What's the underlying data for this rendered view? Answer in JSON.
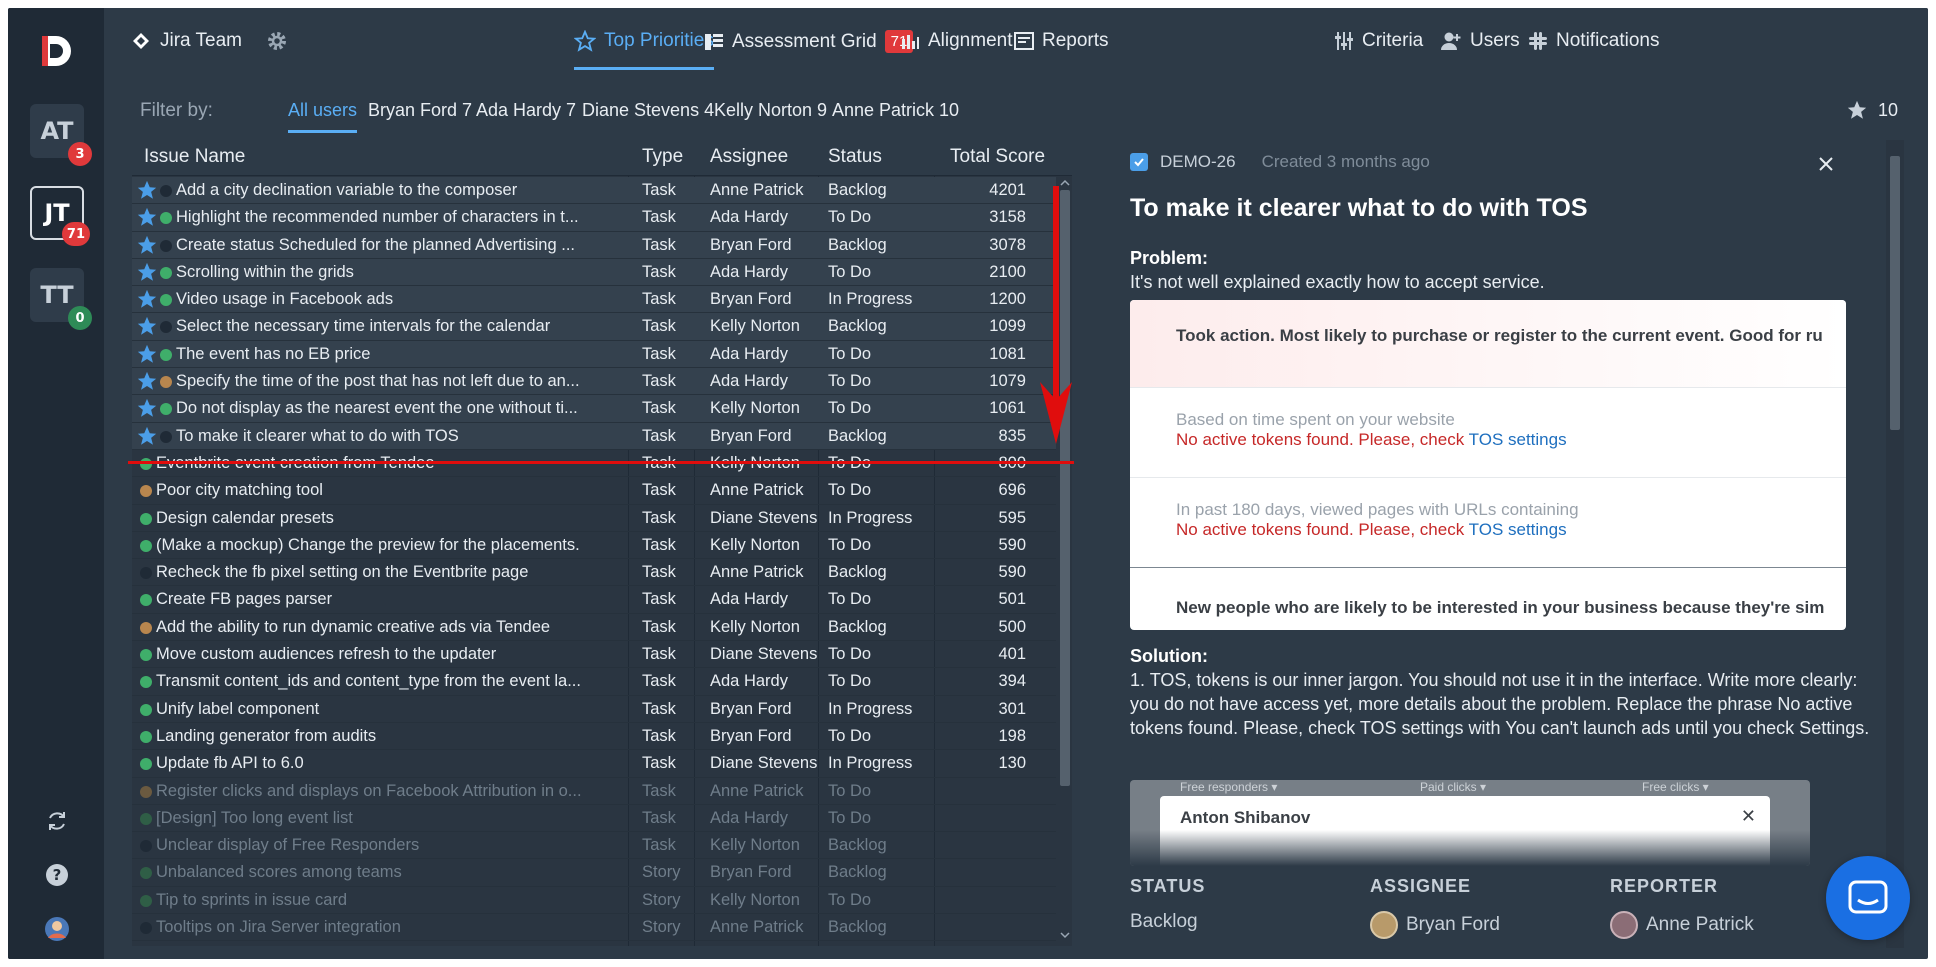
{
  "app": {
    "logo_letter": "D"
  },
  "rail": {
    "workspaces": [
      {
        "label": "AT",
        "badge": "3",
        "badge_color": "#e0393b"
      },
      {
        "label": "JT",
        "badge": "71",
        "badge_color": "#e0393b"
      },
      {
        "label": "TT",
        "badge": "0",
        "badge_color": "#2e8b57"
      }
    ]
  },
  "topnav": {
    "team": "Jira Team",
    "top_priorities": "Top Priorities",
    "assessment_grid": "Assessment Grid",
    "assessment_badge": "71",
    "alignment": "Alignment",
    "reports": "Reports",
    "criteria": "Criteria",
    "users": "Users",
    "notifications": "Notifications"
  },
  "filter": {
    "label": "Filter by:",
    "options": [
      "All users",
      "Bryan Ford 7",
      "Ada Hardy 7",
      "Diane Stevens 4",
      "Kelly Norton 9",
      "Anne Patrick 10"
    ],
    "star_count": "10"
  },
  "table": {
    "headers": {
      "name": "Issue Name",
      "type": "Type",
      "assignee": "Assignee",
      "status": "Status",
      "score": "Total Score"
    },
    "rows": [
      {
        "starred": true,
        "dot": "#1f2a36",
        "name": "Add a city declination variable to the composer",
        "type": "Task",
        "assignee": "Anne Patrick",
        "status": "Backlog",
        "score": "4201"
      },
      {
        "starred": true,
        "dot": "#3fae6a",
        "name": "Highlight the recommended number of characters in t...",
        "type": "Task",
        "assignee": "Ada Hardy",
        "status": "To Do",
        "score": "3158"
      },
      {
        "starred": true,
        "dot": "#1f2a36",
        "name": "Create status Scheduled for the planned Advertising ...",
        "type": "Task",
        "assignee": "Bryan Ford",
        "status": "Backlog",
        "score": "3078"
      },
      {
        "starred": true,
        "dot": "#3fae6a",
        "name": "Scrolling within the grids",
        "type": "Task",
        "assignee": "Ada Hardy",
        "status": "To Do",
        "score": "2100"
      },
      {
        "starred": true,
        "dot": "#3fae6a",
        "name": "Video usage in Facebook ads",
        "type": "Task",
        "assignee": "Bryan Ford",
        "status": "In Progress",
        "score": "1200"
      },
      {
        "starred": true,
        "dot": "#1f2a36",
        "name": "Select the necessary time intervals for the calendar",
        "type": "Task",
        "assignee": "Kelly Norton",
        "status": "Backlog",
        "score": "1099"
      },
      {
        "starred": true,
        "dot": "#3fae6a",
        "name": "The event has no EB price",
        "type": "Task",
        "assignee": "Ada Hardy",
        "status": "To Do",
        "score": "1081"
      },
      {
        "starred": true,
        "dot": "#b8864e",
        "name": "Specify the time of the post that has not left due to an...",
        "type": "Task",
        "assignee": "Ada Hardy",
        "status": "To Do",
        "score": "1079"
      },
      {
        "starred": true,
        "dot": "#3fae6a",
        "name": "Do not display as the nearest event the one without ti...",
        "type": "Task",
        "assignee": "Kelly Norton",
        "status": "To Do",
        "score": "1061"
      },
      {
        "starred": true,
        "dot": "#1f2a36",
        "name": "To make it clearer what to do with TOS",
        "type": "Task",
        "assignee": "Bryan Ford",
        "status": "Backlog",
        "score": "835"
      },
      {
        "starred": false,
        "dot": "#3fae6a",
        "name": "Eventbrite event creation from Tendee",
        "type": "Task",
        "assignee": "Kelly Norton",
        "status": "To Do",
        "score": "800"
      },
      {
        "starred": false,
        "dot": "#b8864e",
        "name": "Poor city matching tool",
        "type": "Task",
        "assignee": "Anne Patrick",
        "status": "To Do",
        "score": "696"
      },
      {
        "starred": false,
        "dot": "#3fae6a",
        "name": "Design calendar presets",
        "type": "Task",
        "assignee": "Diane Stevens",
        "status": "In Progress",
        "score": "595"
      },
      {
        "starred": false,
        "dot": "#3fae6a",
        "name": "(Make a mockup) Change the preview for the placements.",
        "type": "Task",
        "assignee": "Kelly Norton",
        "status": "To Do",
        "score": "590"
      },
      {
        "starred": false,
        "dot": "#1f2a36",
        "name": "Recheck the fb pixel setting on the Eventbrite page",
        "type": "Task",
        "assignee": "Anne Patrick",
        "status": "Backlog",
        "score": "590"
      },
      {
        "starred": false,
        "dot": "#3fae6a",
        "name": "Create FB pages parser",
        "type": "Task",
        "assignee": "Ada Hardy",
        "status": "To Do",
        "score": "501"
      },
      {
        "starred": false,
        "dot": "#b8864e",
        "name": "Add the ability to run dynamic creative ads via Tendee",
        "type": "Task",
        "assignee": "Kelly Norton",
        "status": "Backlog",
        "score": "500"
      },
      {
        "starred": false,
        "dot": "#3fae6a",
        "name": "Move custom audiences refresh to the updater",
        "type": "Task",
        "assignee": "Diane Stevens",
        "status": "To Do",
        "score": "401"
      },
      {
        "starred": false,
        "dot": "#3fae6a",
        "name": "Transmit content_ids and content_type from the event la...",
        "type": "Task",
        "assignee": "Ada Hardy",
        "status": "To Do",
        "score": "394"
      },
      {
        "starred": false,
        "dot": "#3fae6a",
        "name": "Unify label component",
        "type": "Task",
        "assignee": "Bryan Ford",
        "status": "In Progress",
        "score": "301"
      },
      {
        "starred": false,
        "dot": "#3fae6a",
        "name": "Landing generator from audits",
        "type": "Task",
        "assignee": "Bryan Ford",
        "status": "To Do",
        "score": "198"
      },
      {
        "starred": false,
        "dot": "#3fae6a",
        "name": "Update fb API to 6.0",
        "type": "Task",
        "assignee": "Diane Stevens",
        "status": "In Progress",
        "score": "130"
      },
      {
        "starred": false,
        "dim": true,
        "dot": "#6b5a40",
        "name": "Register clicks and displays on Facebook Attribution in o...",
        "type": "Task",
        "assignee": "Anne Patrick",
        "status": "To Do",
        "score": ""
      },
      {
        "starred": false,
        "dim": true,
        "dot": "#2f5e46",
        "name": "[Design] Too long event list",
        "type": "Task",
        "assignee": "Ada Hardy",
        "status": "To Do",
        "score": ""
      },
      {
        "starred": false,
        "dim": true,
        "dot": "#1f2a36",
        "name": "Unclear display of Free Responders",
        "type": "Task",
        "assignee": "Kelly Norton",
        "status": "Backlog",
        "score": ""
      },
      {
        "starred": false,
        "dim": true,
        "dot": "#2f5e46",
        "name": "Unbalanced scores among teams",
        "type": "Story",
        "assignee": "Bryan Ford",
        "status": "Backlog",
        "score": ""
      },
      {
        "starred": false,
        "dim": true,
        "dot": "#2f5e46",
        "name": "Tip to sprints in issue card",
        "type": "Story",
        "assignee": "Kelly Norton",
        "status": "To Do",
        "score": ""
      },
      {
        "starred": false,
        "dim": true,
        "dot": "#1f2a36",
        "name": "Tooltips on Jira Server integration",
        "type": "Story",
        "assignee": "Anne Patrick",
        "status": "Backlog",
        "score": ""
      }
    ]
  },
  "detail": {
    "key": "DEMO-26",
    "created": "Created 3 months ago",
    "title": "To make it clearer what to do with TOS",
    "problem_label": "Problem:",
    "problem_text": "It's not well explained exactly how to accept service.",
    "card": {
      "row1": "Took action. Most likely to purchase or register to the current event. Good for ru",
      "row2_label": "Based on time spent on your website",
      "row3_label": "In past 180 days, viewed pages with URLs containing",
      "error_prefix": "No active tokens found. Please, check ",
      "error_link": "TOS settings",
      "row4": "New people who are likely to be interested in your business because they're sim"
    },
    "solution_label": "Solution:",
    "solution_text": "1. TOS, tokens is our inner jargon. You should not use it in the interface. Write more clearly: you do not have access yet, more details about the problem. Replace the phrase No active tokens found. Please, check TOS settings with You can't launch ads until you check Settings.",
    "screenshot": {
      "col1": "Free responders ▾",
      "col2": "Paid clicks ▾",
      "col3": "Free clicks ▾",
      "modal_name": "Anton Shibanov"
    },
    "status_label": "STATUS",
    "status_value": "Backlog",
    "assignee_label": "ASSIGNEE",
    "assignee_value": "Bryan Ford",
    "reporter_label": "REPORTER",
    "reporter_value": "Anne Patrick"
  }
}
